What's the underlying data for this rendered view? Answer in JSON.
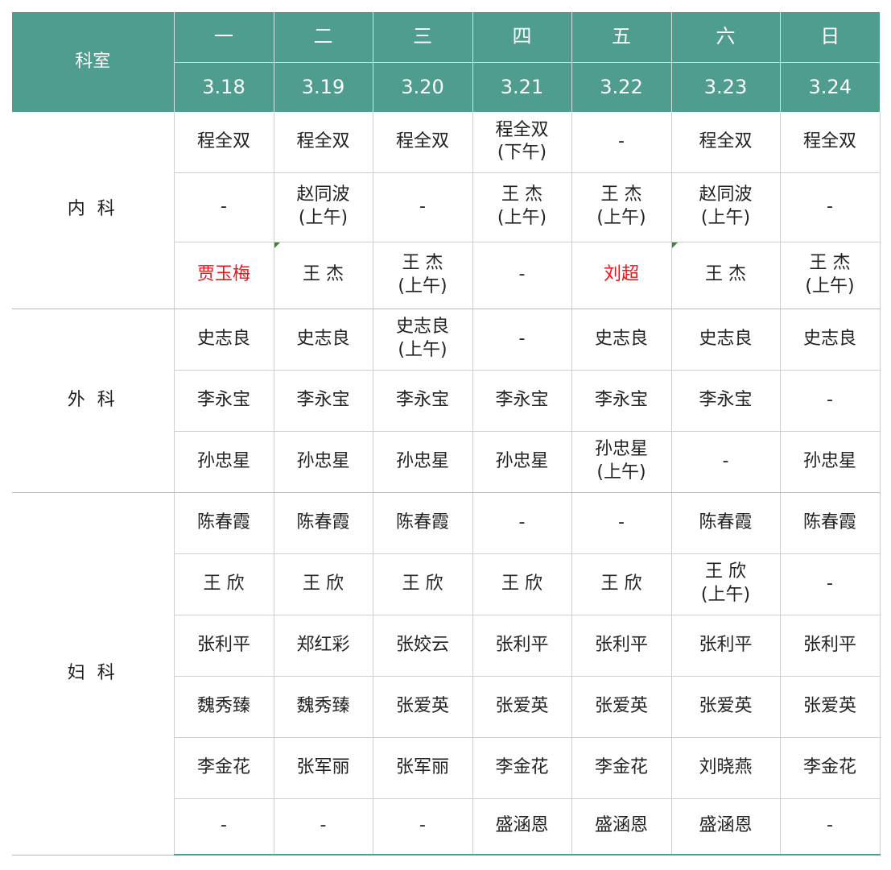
{
  "header": {
    "dept_label": "科室",
    "weekdays": [
      "一",
      "二",
      "三",
      "四",
      "五",
      "六",
      "日"
    ],
    "dates": [
      "3.18",
      "3.19",
      "3.20",
      "3.21",
      "3.22",
      "3.23",
      "3.24"
    ]
  },
  "departments": [
    {
      "name": "内 科",
      "rows": [
        [
          {
            "text": "程全双"
          },
          {
            "text": "程全双"
          },
          {
            "text": "程全双"
          },
          {
            "text": "程全双\n(下午)"
          },
          {
            "text": "-"
          },
          {
            "text": "程全双"
          },
          {
            "text": "程全双"
          }
        ],
        [
          {
            "text": "-"
          },
          {
            "text": "赵同波\n(上午)"
          },
          {
            "text": "-"
          },
          {
            "text": "王  杰\n(上午)"
          },
          {
            "text": "王  杰\n(上午)"
          },
          {
            "text": "赵同波\n(上午)"
          },
          {
            "text": "-"
          }
        ],
        [
          {
            "text": "贾玉梅",
            "red": true
          },
          {
            "text": "王  杰",
            "flag": true
          },
          {
            "text": "王  杰\n(上午)"
          },
          {
            "text": "-"
          },
          {
            "text": "刘超",
            "red": true
          },
          {
            "text": "王  杰",
            "flag": true
          },
          {
            "text": "王  杰\n(上午)"
          }
        ]
      ]
    },
    {
      "name": "外 科",
      "rows": [
        [
          {
            "text": "史志良"
          },
          {
            "text": "史志良"
          },
          {
            "text": "史志良\n(上午)"
          },
          {
            "text": "-"
          },
          {
            "text": "史志良"
          },
          {
            "text": "史志良"
          },
          {
            "text": "史志良"
          }
        ],
        [
          {
            "text": "李永宝"
          },
          {
            "text": "李永宝"
          },
          {
            "text": "李永宝"
          },
          {
            "text": "李永宝"
          },
          {
            "text": "李永宝"
          },
          {
            "text": "李永宝"
          },
          {
            "text": "-"
          }
        ],
        [
          {
            "text": "孙忠星"
          },
          {
            "text": "孙忠星"
          },
          {
            "text": "孙忠星"
          },
          {
            "text": "孙忠星"
          },
          {
            "text": "孙忠星\n(上午)"
          },
          {
            "text": "-"
          },
          {
            "text": "孙忠星"
          }
        ]
      ]
    },
    {
      "name": "妇 科",
      "rows": [
        [
          {
            "text": "陈春霞"
          },
          {
            "text": "陈春霞"
          },
          {
            "text": "陈春霞"
          },
          {
            "text": "-"
          },
          {
            "text": "-"
          },
          {
            "text": "陈春霞"
          },
          {
            "text": "陈春霞"
          }
        ],
        [
          {
            "text": "王  欣"
          },
          {
            "text": "王  欣"
          },
          {
            "text": "王  欣"
          },
          {
            "text": "王  欣"
          },
          {
            "text": "王 欣"
          },
          {
            "text": "王  欣\n(上午)"
          },
          {
            "text": "-"
          }
        ],
        [
          {
            "text": "张利平"
          },
          {
            "text": "郑红彩"
          },
          {
            "text": "张姣云"
          },
          {
            "text": "张利平"
          },
          {
            "text": "张利平"
          },
          {
            "text": "张利平"
          },
          {
            "text": "张利平"
          }
        ],
        [
          {
            "text": "魏秀臻"
          },
          {
            "text": "魏秀臻"
          },
          {
            "text": "张爱英"
          },
          {
            "text": "张爱英"
          },
          {
            "text": "张爱英"
          },
          {
            "text": "张爱英"
          },
          {
            "text": "张爱英"
          }
        ],
        [
          {
            "text": "李金花"
          },
          {
            "text": "张军丽"
          },
          {
            "text": "张军丽"
          },
          {
            "text": "李金花"
          },
          {
            "text": "李金花"
          },
          {
            "text": "刘晓燕"
          },
          {
            "text": "李金花"
          }
        ],
        [
          {
            "text": "-"
          },
          {
            "text": "-"
          },
          {
            "text": "-"
          },
          {
            "text": "盛涵恩"
          },
          {
            "text": "盛涵恩"
          },
          {
            "text": "盛涵恩"
          },
          {
            "text": "-"
          }
        ]
      ]
    }
  ]
}
